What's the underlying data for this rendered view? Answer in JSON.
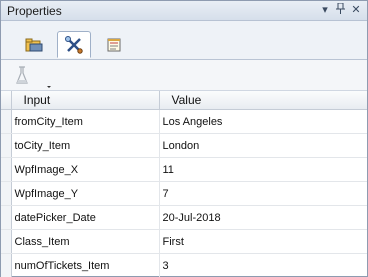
{
  "panel": {
    "title": "Properties"
  },
  "titlebar": {
    "dropdown_glyph": "▾",
    "pin_glyph": "ᵠ",
    "close_glyph": "✕"
  },
  "tabs": [
    {
      "icon": "folder-icon",
      "active": false
    },
    {
      "icon": "tools-icon",
      "active": true
    },
    {
      "icon": "notepad-icon",
      "active": false
    }
  ],
  "toolbar": {
    "data_button_icon": "flask-icon"
  },
  "table": {
    "columns": [
      "Input",
      "Value"
    ],
    "rows": [
      {
        "input": "fromCity_Item",
        "value": "Los Angeles"
      },
      {
        "input": "toCity_Item",
        "value": "London"
      },
      {
        "input": "WpfImage_X",
        "value": "11"
      },
      {
        "input": "WpfImage_Y",
        "value": "7"
      },
      {
        "input": "datePicker_Date",
        "value": "20-Jul-2018"
      },
      {
        "input": "Class_Item",
        "value": "First"
      },
      {
        "input": "numOfTickets_Item",
        "value": "3"
      }
    ]
  },
  "colors": {
    "header_bg": "#dbe3ee",
    "accent": "#3a6fb0"
  }
}
